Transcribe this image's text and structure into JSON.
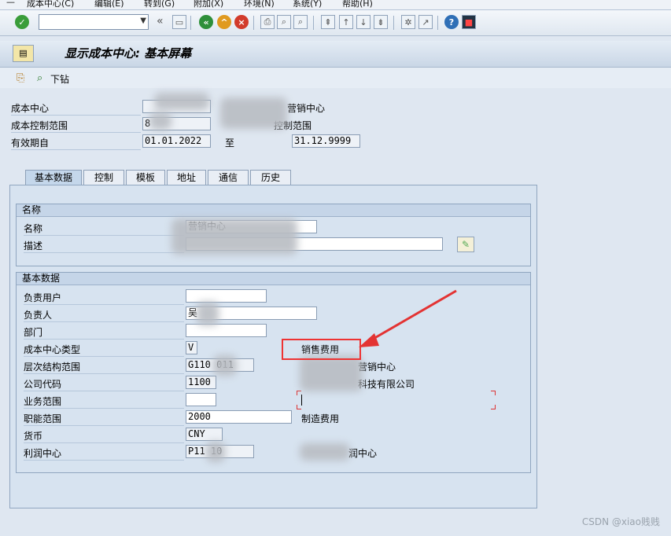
{
  "menu": {
    "items": [
      "成本中心(C)",
      "编辑(E)",
      "转到(G)",
      "附加(X)",
      "环境(N)",
      "系统(Y)",
      "帮助(H)"
    ]
  },
  "toolbar": {
    "command_value": "",
    "nav_back_glyph": "«"
  },
  "title": "显示成本中心: 基本屏幕",
  "apptool": {
    "drilldown_label": "下钻"
  },
  "header": {
    "cost_center_label": "成本中心",
    "cost_center_value": "",
    "cost_center_desc": "营销中心",
    "controlling_area_label": "成本控制范围",
    "controlling_area_value": "8",
    "controlling_area_desc": "控制范围",
    "valid_from_label": "有效期自",
    "valid_from": "01.01.2022",
    "to_label": "至",
    "valid_to": "31.12.9999"
  },
  "tabs": [
    "基本数据",
    "控制",
    "模板",
    "地址",
    "通信",
    "历史"
  ],
  "group_names": {
    "title": "名称",
    "name_label": "名称",
    "name_value": "营销中心",
    "desc_label": "描述",
    "desc_value": ""
  },
  "group_basic": {
    "title": "基本数据",
    "rows": [
      {
        "label": "负责用户",
        "value": "",
        "desc": ""
      },
      {
        "label": "负责人",
        "value": "吴",
        "desc": ""
      },
      {
        "label": "部门",
        "value": "",
        "desc": ""
      },
      {
        "label": "成本中心类型",
        "value": "V",
        "desc": "销售费用"
      },
      {
        "label": "层次结构范围",
        "value": "G110  011",
        "desc": "营销中心"
      },
      {
        "label": "公司代码",
        "value": "1100",
        "desc": "科技有限公司"
      },
      {
        "label": "业务范围",
        "value": "",
        "desc": ""
      },
      {
        "label": "职能范围",
        "value": "2000",
        "desc": "制造费用"
      },
      {
        "label": "货币",
        "value": "CNY",
        "desc": ""
      },
      {
        "label": "利润中心",
        "value": "P11  10",
        "desc": "润中心"
      }
    ]
  },
  "watermark": "CSDN @xiao贱贱",
  "colors": {
    "annotation": "#e33333",
    "panel": "#d7e3f0"
  }
}
